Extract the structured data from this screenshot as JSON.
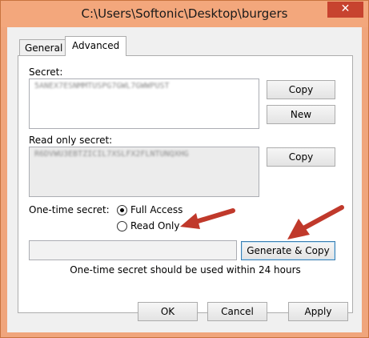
{
  "window": {
    "title": "C:\\Users\\Softonic\\Desktop\\burgers",
    "close_glyph": "✕"
  },
  "tabs": [
    {
      "label": "General",
      "selected": false
    },
    {
      "label": "Advanced",
      "selected": true
    }
  ],
  "secret": {
    "label": "Secret:",
    "value": "5ANEX7ESNMMTUSPG7GWL7GWWPUST",
    "copy_label": "Copy",
    "new_label": "New"
  },
  "read_only_secret": {
    "label": "Read only secret:",
    "value": "R6DVWU3EBTZICIL7XSLFX2FLNTUNQXHG",
    "copy_label": "Copy"
  },
  "one_time": {
    "label": "One-time secret:",
    "options": [
      {
        "label": "Full Access",
        "selected": true
      },
      {
        "label": "Read Only",
        "selected": false
      }
    ],
    "value": "",
    "generate_label": "Generate & Copy",
    "note": "One-time secret should be used within 24 hours"
  },
  "footer": {
    "ok_label": "OK",
    "cancel_label": "Cancel",
    "apply_label": "Apply"
  },
  "colors": {
    "annotation_arrow": "#c0392b",
    "title_bar": "#f3a77c",
    "close_button": "#c7432f"
  }
}
